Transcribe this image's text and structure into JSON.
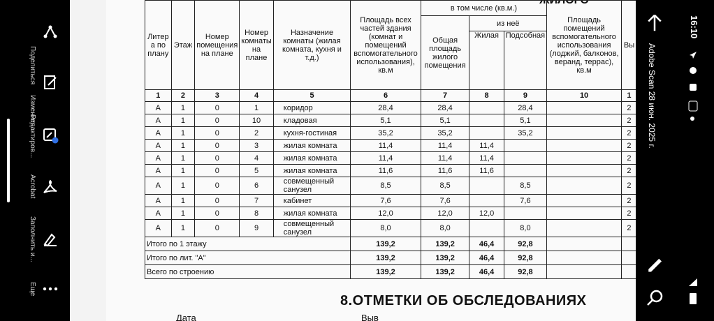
{
  "left_toolbar": {
    "items": [
      {
        "label": "Поделиться",
        "icon": "share-icon"
      },
      {
        "label": "Изменить",
        "icon": "edit-document-icon"
      },
      {
        "label": "Редактиров...",
        "icon": "edit-pdf-icon"
      },
      {
        "label": "Acrobat",
        "icon": "acrobat-icon"
      },
      {
        "label": "Заполнить и...",
        "icon": "fill-sign-icon"
      },
      {
        "label": "Еще",
        "icon": "more-icon"
      }
    ]
  },
  "document": {
    "header_top": "ЖИЛОГО",
    "headers": {
      "h1": "Литер а по плану",
      "h2": "Этаж",
      "h3": "Номер помещения на плане",
      "h4": "Номер комнаты на плане",
      "h5": "Назначение комнаты (жилая комната, кухня и т.д.)",
      "h6": "Площадь всех частей здания (комнат и помещений вспомогательного использования), кв.м",
      "h_incl": "в том числе (кв.м.)",
      "h7": "Общая площадь жилого помещения",
      "h_of": "из неё",
      "h8": "Жилая",
      "h9": "Подсобная",
      "h10": "Площадь помещений вспомогательного использования (лоджий, балконов, веранд, террас), кв.м",
      "h11": "Вы"
    },
    "col_numbers": [
      "1",
      "2",
      "3",
      "4",
      "5",
      "6",
      "7",
      "8",
      "9",
      "10",
      "1"
    ],
    "rows": [
      {
        "liter": "А",
        "floor": "1",
        "room_no": "0",
        "room": "1",
        "purpose": "коридор",
        "total": "28,4",
        "general": "28,4",
        "living": "",
        "aux": "28,4",
        "extra": "2"
      },
      {
        "liter": "А",
        "floor": "1",
        "room_no": "0",
        "room": "10",
        "purpose": "кладовая",
        "total": "5,1",
        "general": "5,1",
        "living": "",
        "aux": "5,1",
        "extra": "2"
      },
      {
        "liter": "А",
        "floor": "1",
        "room_no": "0",
        "room": "2",
        "purpose": "кухня-гостиная",
        "total": "35,2",
        "general": "35,2",
        "living": "",
        "aux": "35,2",
        "extra": "2"
      },
      {
        "liter": "А",
        "floor": "1",
        "room_no": "0",
        "room": "3",
        "purpose": "жилая комната",
        "total": "11,4",
        "general": "11,4",
        "living": "11,4",
        "aux": "",
        "extra": "2"
      },
      {
        "liter": "А",
        "floor": "1",
        "room_no": "0",
        "room": "4",
        "purpose": "жилая комната",
        "total": "11,4",
        "general": "11,4",
        "living": "11,4",
        "aux": "",
        "extra": "2"
      },
      {
        "liter": "А",
        "floor": "1",
        "room_no": "0",
        "room": "5",
        "purpose": "жилая комната",
        "total": "11,6",
        "general": "11,6",
        "living": "11,6",
        "aux": "",
        "extra": "2"
      },
      {
        "liter": "А",
        "floor": "1",
        "room_no": "0",
        "room": "6",
        "purpose": "совмещенный санузел",
        "total": "8,5",
        "general": "8,5",
        "living": "",
        "aux": "8,5",
        "extra": "2"
      },
      {
        "liter": "А",
        "floor": "1",
        "room_no": "0",
        "room": "7",
        "purpose": "кабинет",
        "total": "7,6",
        "general": "7,6",
        "living": "",
        "aux": "7,6",
        "extra": "2"
      },
      {
        "liter": "А",
        "floor": "1",
        "room_no": "0",
        "room": "8",
        "purpose": "жилая комната",
        "total": "12,0",
        "general": "12,0",
        "living": "12,0",
        "aux": "",
        "extra": "2"
      },
      {
        "liter": "А",
        "floor": "1",
        "room_no": "0",
        "room": "9",
        "purpose": "совмещенный санузел",
        "total": "8,0",
        "general": "8,0",
        "living": "",
        "aux": "8,0",
        "extra": "2"
      }
    ],
    "totals": [
      {
        "label": "Итого по 1 этажу",
        "total": "139,2",
        "general": "139,2",
        "living": "46,4",
        "aux": "92,8"
      },
      {
        "label": "Итого по лит. \"А\"",
        "total": "139,2",
        "general": "139,2",
        "living": "46,4",
        "aux": "92,8"
      },
      {
        "label": "Всего по строению",
        "total": "139,2",
        "general": "139,2",
        "living": "46,4",
        "aux": "92,8"
      }
    ],
    "section_title": "8.ОТМЕТКИ ОБ ОБСЛЕДОВАНИЯХ",
    "bottom_left": "Дата",
    "bottom_right": "Выв"
  },
  "status_bar": {
    "time": "16:10",
    "notification": "Adobe Scan 28 июн. 2025 г."
  },
  "nav": {
    "back": "back-arrow-icon",
    "edit": "pencil-icon",
    "search": "search-icon"
  }
}
